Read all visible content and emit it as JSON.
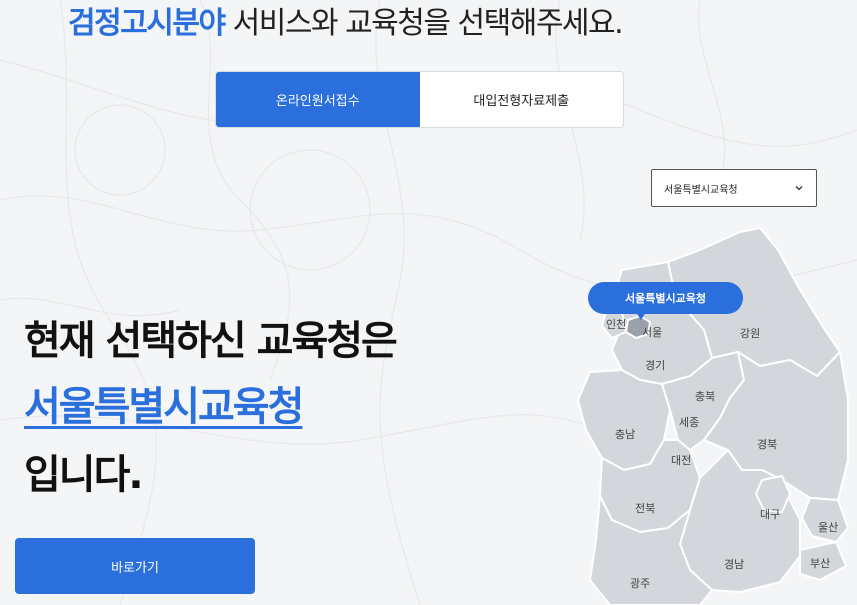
{
  "header": {
    "title_accent": "검정고시분야",
    "title_rest": " 서비스와 교육청을 선택해주세요."
  },
  "tabs": [
    {
      "label": "온라인원서접수",
      "active": true
    },
    {
      "label": "대입전형자료제출",
      "active": false
    }
  ],
  "office_select": {
    "value": "서울특별시교육청",
    "icon": "chevron-down-icon"
  },
  "map": {
    "selected_marker": "서울특별시교육청",
    "regions": {
      "incheon": "인천",
      "seoul": "서울",
      "gangwon": "강원",
      "gyeonggi": "경기",
      "chungbuk": "충북",
      "sejong": "세종",
      "chungnam": "충남",
      "gyeongbuk": "경북",
      "daejeon": "대전",
      "jeonbuk": "전북",
      "daegu": "대구",
      "ulsan": "울산",
      "busan": "부산",
      "gyeongnam": "경남",
      "gwangju": "광주"
    }
  },
  "main": {
    "line1": "현재 선택하신 교육청은",
    "line2": "서울특별시교육청",
    "line3": "입니다.",
    "go_button": "바로가기"
  },
  "colors": {
    "accent": "#2a6fdb",
    "background": "#f4f5f6",
    "map_fill": "#d3d6da"
  }
}
